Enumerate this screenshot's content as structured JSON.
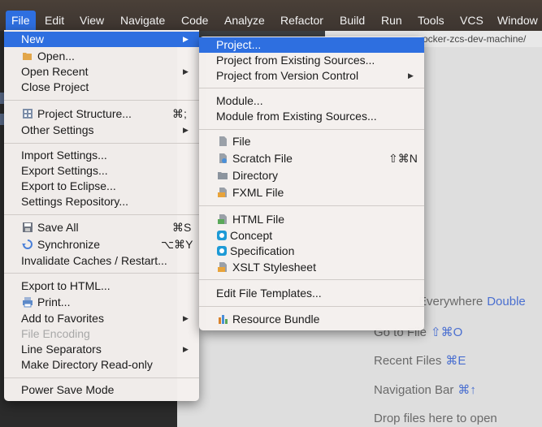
{
  "menubar": [
    "File",
    "Edit",
    "View",
    "Navigate",
    "Code",
    "Analyze",
    "Refactor",
    "Build",
    "Run",
    "Tools",
    "VCS",
    "Window"
  ],
  "bg_path": "ocker-zcs-dev-machine/",
  "welcome_hints": [
    {
      "text": "Everywhere",
      "shortcut": "Double"
    },
    {
      "text": "Go to File",
      "shortcut": "⇧⌘O"
    },
    {
      "text": "Recent Files",
      "shortcut": "⌘E"
    },
    {
      "text": "Navigation Bar",
      "shortcut": "⌘↑"
    },
    {
      "text": "Drop files here to open",
      "shortcut": ""
    }
  ],
  "file_menu": {
    "new": "New",
    "open": "Open...",
    "open_recent": "Open Recent",
    "close_project": "Close Project",
    "project_structure": "Project Structure...",
    "project_structure_sc": "⌘;",
    "other_settings": "Other Settings",
    "import_settings": "Import Settings...",
    "export_settings": "Export Settings...",
    "export_eclipse": "Export to Eclipse...",
    "settings_repo": "Settings Repository...",
    "save_all": "Save All",
    "save_all_sc": "⌘S",
    "synchronize": "Synchronize",
    "synchronize_sc": "⌥⌘Y",
    "invalidate": "Invalidate Caches / Restart...",
    "export_html": "Export to HTML...",
    "print": "Print...",
    "add_favorites": "Add to Favorites",
    "file_encoding": "File Encoding",
    "line_separators": "Line Separators",
    "make_readonly": "Make Directory Read-only",
    "power_save": "Power Save Mode"
  },
  "new_menu": {
    "project": "Project...",
    "from_existing": "Project from Existing Sources...",
    "from_vcs": "Project from Version Control",
    "module": "Module...",
    "module_existing": "Module from Existing Sources...",
    "file": "File",
    "scratch": "Scratch File",
    "scratch_sc": "⇧⌘N",
    "directory": "Directory",
    "fxml": "FXML File",
    "html": "HTML File",
    "concept": "Concept",
    "specification": "Specification",
    "xslt": "XSLT Stylesheet",
    "edit_templates": "Edit File Templates...",
    "resource_bundle": "Resource Bundle"
  }
}
